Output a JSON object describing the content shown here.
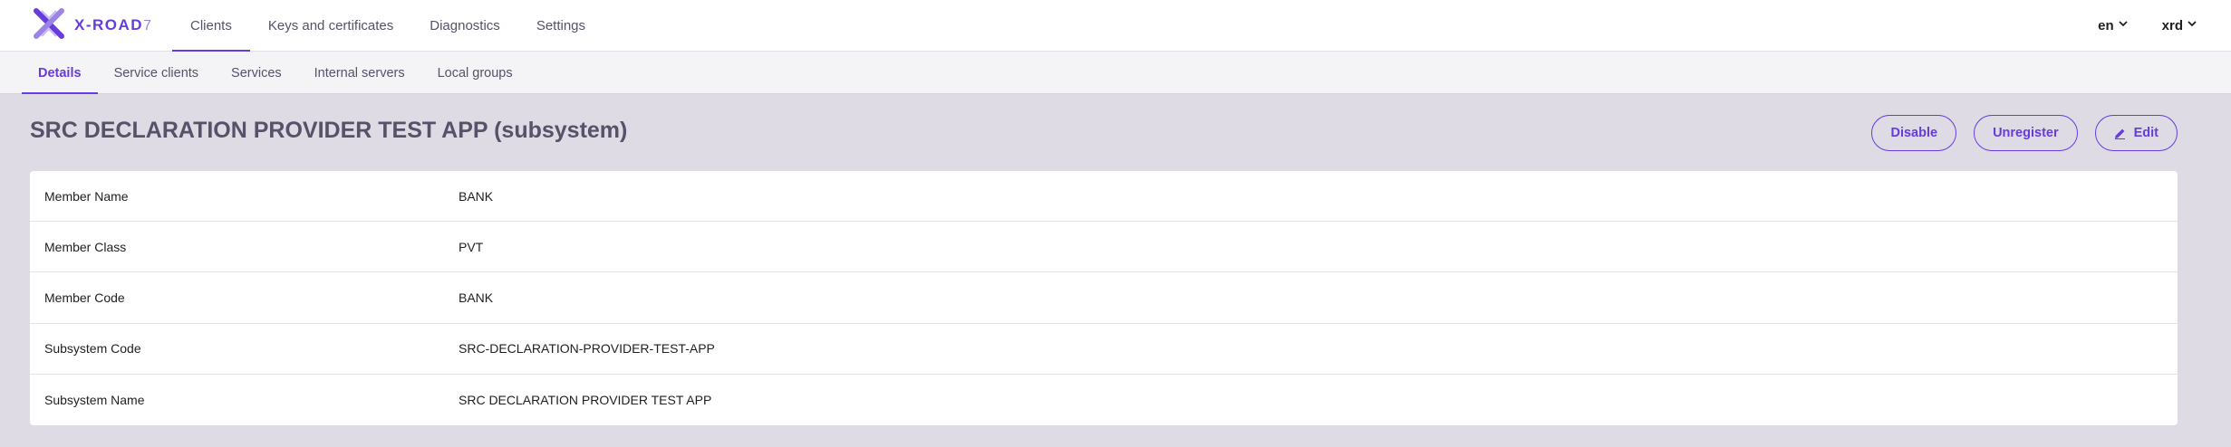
{
  "app": {
    "logo_text": "X-ROAD",
    "logo_version": "7"
  },
  "nav": {
    "tabs": [
      {
        "label": "Clients"
      },
      {
        "label": "Keys and certificates"
      },
      {
        "label": "Diagnostics"
      },
      {
        "label": "Settings"
      }
    ],
    "active_tab": "Clients",
    "language": "en",
    "user": "xrd"
  },
  "subnav": {
    "tabs": [
      {
        "label": "Details"
      },
      {
        "label": "Service clients"
      },
      {
        "label": "Services"
      },
      {
        "label": "Internal servers"
      },
      {
        "label": "Local groups"
      }
    ],
    "active_tab": "Details"
  },
  "page": {
    "title": "SRC DECLARATION PROVIDER TEST APP (subsystem)",
    "actions": {
      "disable_label": "Disable",
      "unregister_label": "Unregister",
      "edit_label": "Edit"
    }
  },
  "details": [
    {
      "label": "Member Name",
      "value": "BANK"
    },
    {
      "label": "Member Class",
      "value": "PVT"
    },
    {
      "label": "Member Code",
      "value": "BANK"
    },
    {
      "label": "Subsystem Code",
      "value": "SRC-DECLARATION-PROVIDER-TEST-APP"
    },
    {
      "label": "Subsystem Name",
      "value": "SRC DECLARATION PROVIDER TEST APP"
    }
  ],
  "colors": {
    "accent": "#663cdc",
    "page_background": "#dedbe4",
    "title_text": "#575169"
  },
  "icons": {
    "logo": "x-road-logo-icon",
    "dropdown": "chevron-down-icon",
    "edit": "pencil-icon"
  }
}
